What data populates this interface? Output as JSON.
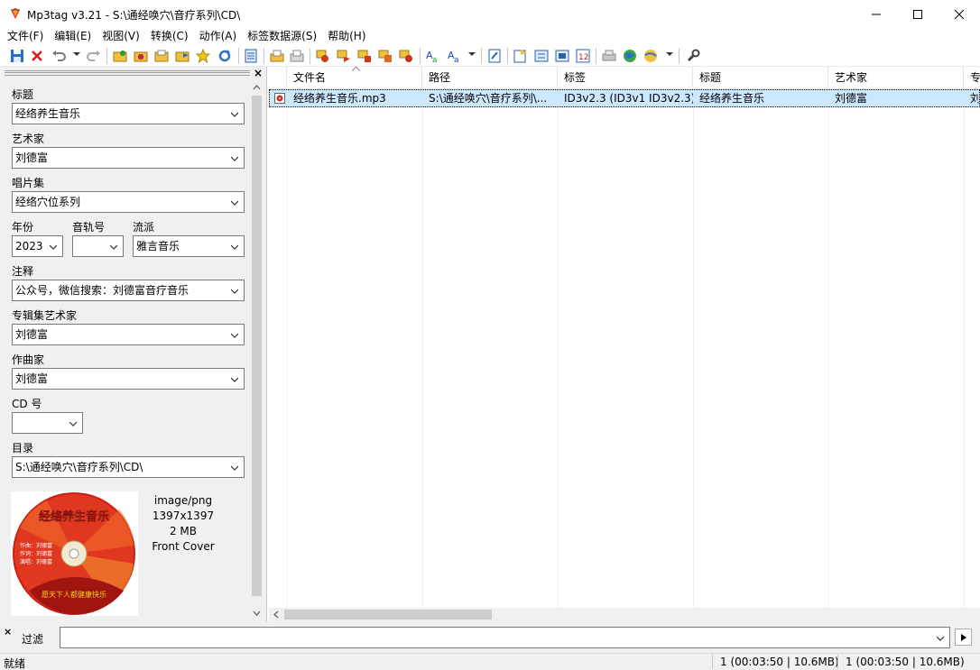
{
  "window": {
    "title": "Mp3tag v3.21  -  S:\\通经唤穴\\音疗系列\\CD\\"
  },
  "menu": [
    "文件(F)",
    "编辑(E)",
    "视图(V)",
    "转换(C)",
    "动作(A)",
    "标签数据源(S)",
    "帮助(H)"
  ],
  "tag_panel": {
    "title_label": "标题",
    "title_value": "经络养生音乐",
    "artist_label": "艺术家",
    "artist_value": "刘德富",
    "album_label": "唱片集",
    "album_value": "经络穴位系列",
    "year_label": "年份",
    "year_value": "2023",
    "track_label": "音轨号",
    "track_value": "",
    "genre_label": "流派",
    "genre_value": "雅言音乐",
    "comment_label": "注释",
    "comment_value": "公众号，微信搜索：刘德富音疗音乐",
    "album_artist_label": "专辑集艺术家",
    "album_artist_value": "刘德富",
    "composer_label": "作曲家",
    "composer_value": "刘德富",
    "disc_label": "CD 号",
    "disc_value": "",
    "directory_label": "目录",
    "directory_value": "S:\\通经唤穴\\音疗系列\\CD\\"
  },
  "cover": {
    "mime": "image/png",
    "dimensions": "1397x1397",
    "size": "2 MB",
    "type": "Front Cover",
    "art_title": "经络养生音乐",
    "art_lines": [
      "作曲：刘德富",
      "作词：刘德富",
      "演唱：刘德富"
    ],
    "art_bottom": "愿天下人都健康快乐"
  },
  "file_list": {
    "columns": [
      "文件名",
      "路径",
      "标签",
      "标题",
      "艺术家",
      "专"
    ],
    "rows": [
      {
        "filename": "经络养生音乐.mp3",
        "path": "S:\\通经唤穴\\音疗系列\\...",
        "tag": "ID3v2.3 (ID3v1 ID3v2.3)",
        "title": "经络养生音乐",
        "artist": "刘德富",
        "album": "刘"
      }
    ]
  },
  "filter": {
    "label": "过滤",
    "value": ""
  },
  "status": {
    "left": "就绪",
    "selected": "1 (00:03:50 | 10.6MB)",
    "total": "1 (00:03:50 | 10.6MB)"
  },
  "colors": {
    "selection": "#cce8ff",
    "panel_bg": "#f0f0f0",
    "cover_red": "#d42a1a",
    "cover_gold": "#f5d020"
  }
}
